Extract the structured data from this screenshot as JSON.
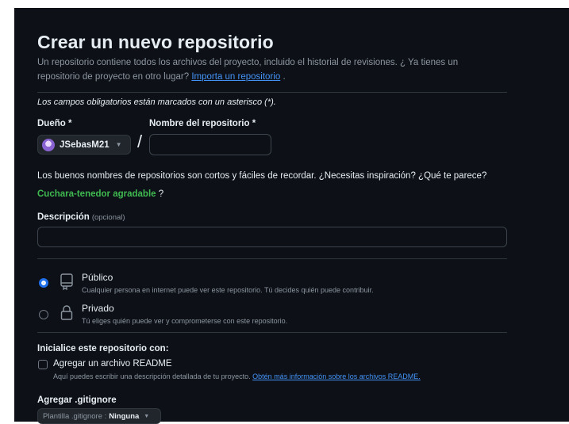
{
  "page": {
    "title": "Crear un nuevo repositorio",
    "subtitle_prefix": "Un repositorio contiene todos los archivos del proyecto, incluido el historial de revisiones. ¿ Ya tienes un repositorio de proyecto en otro lugar?",
    "import_link": "Importa un repositorio",
    "subtitle_suffix": ".",
    "required_note": "Los campos obligatorios están marcados con un asterisco (*)."
  },
  "owner": {
    "label": "Dueño *",
    "value": "JSebasM21"
  },
  "repo_name": {
    "label": "Nombre del repositorio *",
    "value": "",
    "separator": "/"
  },
  "name_hint": "Los buenos nombres de repositorios son cortos y fáciles de recordar. ¿Necesitas inspiración? ¿Qué te parece?",
  "suggestion": {
    "name": "Cuchara-tenedor agradable",
    "suffix": " ?"
  },
  "description": {
    "label": "Descripción",
    "optional": "(opcional)",
    "value": ""
  },
  "visibility": {
    "options": [
      {
        "title": "Público",
        "description": "Cualquier persona en internet puede ver este repositorio. Tú decides quién puede contribuir.",
        "selected": true,
        "icon": "repo-icon"
      },
      {
        "title": "Privado",
        "description": "Tú eliges quién puede ver y comprometerse con este repositorio.",
        "selected": false,
        "icon": "lock-icon"
      }
    ]
  },
  "initialize": {
    "title": "Inicialice este repositorio con:",
    "readme_label": "Agregar un archivo README",
    "readme_checked": false,
    "readme_desc": "Aquí puedes escribir una descripción detallada de tu proyecto.",
    "readme_link": "Obtén más información sobre los archivos README."
  },
  "gitignore": {
    "title": "Agregar .gitignore",
    "prefix": "Plantilla .gitignore :",
    "value": "Ninguna"
  },
  "colors": {
    "background": "#0d1117",
    "text": "#e6edf3",
    "muted": "#8d96a0",
    "link": "#4493f8",
    "accent": "#1f6feb",
    "suggestion": "#3fb950",
    "border": "#30363d"
  }
}
